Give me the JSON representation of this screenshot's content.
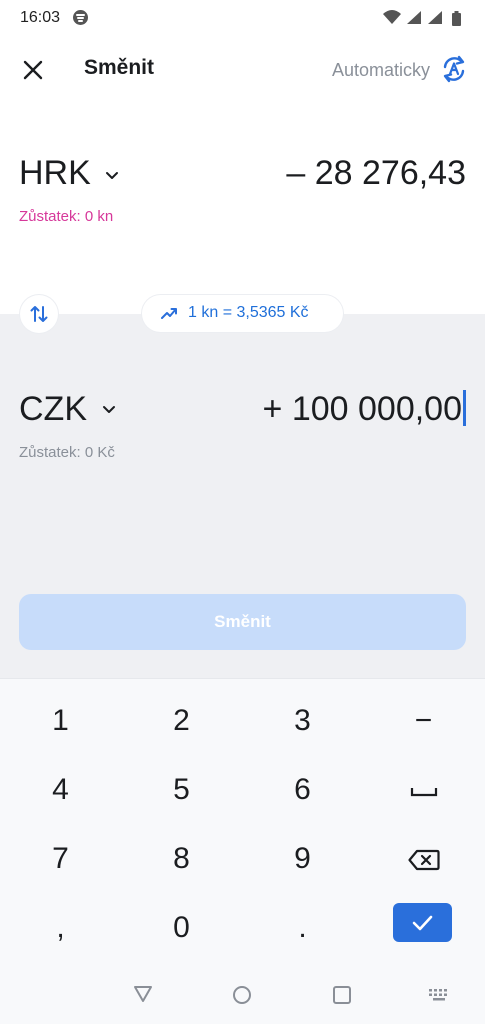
{
  "status_bar": {
    "time": "16:03"
  },
  "header": {
    "title": "Směnit",
    "auto_label": "Automaticky"
  },
  "from": {
    "currency": "HRK",
    "amount": "– 28 276,43",
    "balance": "Zůstatek: 0 kn"
  },
  "rate": {
    "text": "1 kn = 3,5365 Kč"
  },
  "to": {
    "currency": "CZK",
    "amount": "+ 100 000,00",
    "balance": "Zůstatek: 0 Kč"
  },
  "action": {
    "button_label": "Směnit"
  },
  "keypad": {
    "keys": [
      "1",
      "2",
      "3",
      "−",
      "4",
      "5",
      "6",
      "7",
      "8",
      "9",
      ",",
      "0",
      "."
    ]
  },
  "colors": {
    "accent": "#2a6fdb",
    "balance_negative": "#d6389a",
    "button_disabled": "#c7dcfa",
    "panel_bg": "#eff0f3"
  },
  "icons": [
    "spotify-icon",
    "wifi-icon",
    "signal-icon",
    "battery-icon",
    "close-icon",
    "auto-exchange-icon",
    "chevron-down-icon",
    "swap-icon",
    "trend-up-icon",
    "space-key-icon",
    "backspace-icon",
    "check-icon",
    "nav-back-icon",
    "nav-home-icon",
    "nav-recents-icon",
    "keyboard-icon"
  ]
}
